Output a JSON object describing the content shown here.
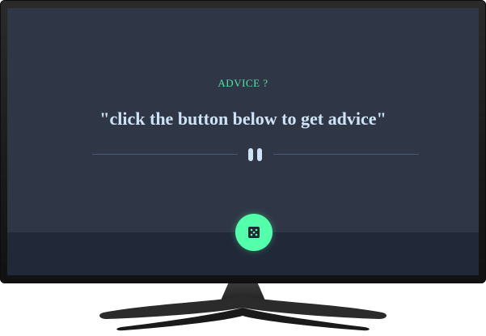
{
  "advice": {
    "heading": "ADVICE ?",
    "quote": "\"click the button below to get advice\""
  },
  "icons": {
    "divider": "pause-icon",
    "button": "dice-icon"
  },
  "colors": {
    "screen_bg": "#2f3746",
    "accent": "#53ffaa",
    "heading": "#53e3a6",
    "quote_text": "#cfe3f6"
  }
}
